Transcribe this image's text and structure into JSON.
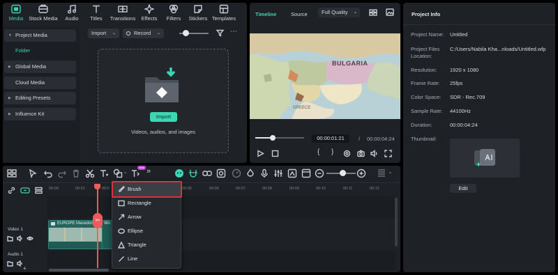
{
  "media_tabs": [
    {
      "label": "Media",
      "icon": "media-icon",
      "active": true
    },
    {
      "label": "Stock Media",
      "icon": "stock-media-icon"
    },
    {
      "label": "Audio",
      "icon": "audio-icon"
    },
    {
      "label": "Titles",
      "icon": "titles-icon"
    },
    {
      "label": "Transitions",
      "icon": "transitions-icon"
    },
    {
      "label": "Effects",
      "icon": "effects-icon"
    },
    {
      "label": "Filters",
      "icon": "filters-icon"
    },
    {
      "label": "Stickers",
      "icon": "stickers-icon"
    },
    {
      "label": "Templates",
      "icon": "templates-icon"
    }
  ],
  "sidebar": {
    "items": [
      {
        "label": "Project Media",
        "expanded": true
      },
      {
        "label": "Folder"
      },
      {
        "label": "Global Media"
      },
      {
        "label": "Cloud Media"
      },
      {
        "label": "Editing Presets"
      },
      {
        "label": "Influence Kit"
      }
    ]
  },
  "media_toolbar": {
    "import_label": "Import",
    "record_label": "Record"
  },
  "drop_zone": {
    "button_label": "Import",
    "hint": "Videos, audios, and images"
  },
  "preview": {
    "tab_timeline": "Timeline",
    "tab_source": "Source",
    "quality": "Full Quality",
    "map_labels": [
      "BULGARIA",
      "GREECE"
    ],
    "current_time": "00:00:01:21",
    "separator": "/",
    "total_time": "00:00:04:24",
    "progress": 0.28
  },
  "project_info": {
    "title": "Project Info",
    "rows": [
      {
        "label": "Project Name:",
        "value": "Untitled"
      },
      {
        "label": "Project Files Location:",
        "value": "C:/Users/Nabila Kha...nloads/Untitled.wfp"
      },
      {
        "label": "Resolution:",
        "value": "1920 x 1080"
      },
      {
        "label": "Frame Rate:",
        "value": "25fps"
      },
      {
        "label": "Color Space:",
        "value": "SDR - Rec.709"
      },
      {
        "label": "Sample Rate:",
        "value": "44100Hz"
      },
      {
        "label": "Duration:",
        "value": "00:00:04:24"
      },
      {
        "label": "Thumbnail:",
        "value": ""
      }
    ],
    "edit_label": "Edit"
  },
  "timeline": {
    "ruler": [
      "00:00",
      "00:01",
      "00:0",
      "00:05",
      "00:06",
      "00:07",
      "00:08",
      "00:09",
      "00:10",
      "00:11",
      "00:12"
    ],
    "tracks": [
      {
        "label": "Video 1"
      },
      {
        "label": "Audio 1"
      }
    ],
    "clip_label": "EUROPE Macedon",
    "clip_label_2": "Wo",
    "ai_badge": "new"
  },
  "draw_menu": {
    "items": [
      {
        "label": "Brush",
        "icon": "brush-icon",
        "highlighted": true
      },
      {
        "label": "Rectangle",
        "icon": "rectangle-icon"
      },
      {
        "label": "Arrow",
        "icon": "arrow-icon"
      },
      {
        "label": "Ellipse",
        "icon": "ellipse-icon"
      },
      {
        "label": "Triangle",
        "icon": "triangle-icon"
      },
      {
        "label": "Line",
        "icon": "line-icon"
      }
    ]
  },
  "colors": {
    "accent": "#3cd6b4",
    "highlight_border": "#e0313a",
    "playhead": "#f05a5a"
  }
}
